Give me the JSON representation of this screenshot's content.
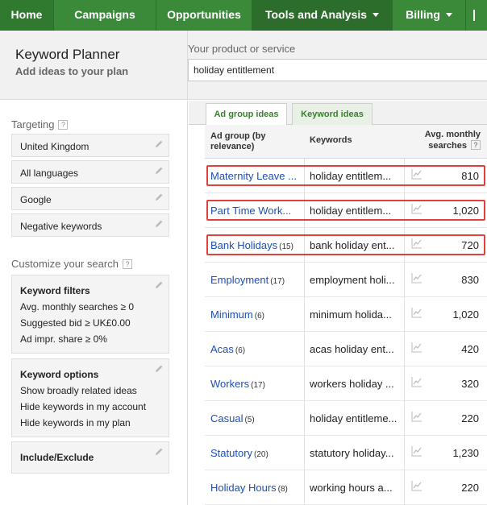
{
  "nav": {
    "home": "Home",
    "campaigns": "Campaigns",
    "opportunities": "Opportunities",
    "tools": "Tools and Analysis",
    "billing": "Billing"
  },
  "header": {
    "title": "Keyword Planner",
    "subtitle": "Add ideas to your plan",
    "product_label": "Your product or service",
    "product_value": "holiday entitlement"
  },
  "sidebar": {
    "targeting_label": "Targeting",
    "targeting_items": [
      "United Kingdom",
      "All languages",
      "Google",
      "Negative keywords"
    ],
    "customize_label": "Customize your search",
    "keyword_filters": {
      "title": "Keyword filters",
      "lines": [
        "Avg. monthly searches ≥ 0",
        "Suggested bid ≥ UK£0.00",
        "Ad impr. share ≥ 0%"
      ]
    },
    "keyword_options": {
      "title": "Keyword options",
      "lines": [
        "Show broadly related ideas",
        "Hide keywords in my account",
        "Hide keywords in my plan"
      ]
    },
    "include_exclude": "Include/Exclude",
    "help_glyph": "?"
  },
  "tabs": {
    "ad_group_ideas": "Ad group ideas",
    "keyword_ideas": "Keyword ideas"
  },
  "table": {
    "headers": {
      "ad_group": "Ad group (by relevance)",
      "keywords": "Keywords",
      "avg_searches": "Avg. monthly searches"
    },
    "rows": [
      {
        "group": "Maternity Leave ...",
        "count": "",
        "keywords": "holiday entitlem...",
        "volume": "810",
        "highlight": true
      },
      {
        "group": "Part Time Work...",
        "count": "",
        "keywords": "holiday entitlem...",
        "volume": "1,020",
        "highlight": true
      },
      {
        "group": "Bank Holidays",
        "count": "(15)",
        "keywords": "bank holiday ent...",
        "volume": "720",
        "highlight": true
      },
      {
        "group": "Employment",
        "count": "(17)",
        "keywords": "employment holi...",
        "volume": "830",
        "highlight": false
      },
      {
        "group": "Minimum",
        "count": "(6)",
        "keywords": "minimum holida...",
        "volume": "1,020",
        "highlight": false
      },
      {
        "group": "Acas",
        "count": "(6)",
        "keywords": "acas holiday ent...",
        "volume": "420",
        "highlight": false
      },
      {
        "group": "Workers",
        "count": "(17)",
        "keywords": "workers holiday ...",
        "volume": "320",
        "highlight": false
      },
      {
        "group": "Casual",
        "count": "(5)",
        "keywords": "holiday entitleme...",
        "volume": "220",
        "highlight": false
      },
      {
        "group": "Statutory",
        "count": "(20)",
        "keywords": "statutory holiday...",
        "volume": "1,230",
        "highlight": false
      },
      {
        "group": "Holiday Hours",
        "count": "(8)",
        "keywords": "working hours a...",
        "volume": "220",
        "highlight": false
      }
    ]
  },
  "colors": {
    "nav_green": "#3b8a3a",
    "link_blue": "#1f4eb4",
    "highlight_red": "#e0413b"
  }
}
